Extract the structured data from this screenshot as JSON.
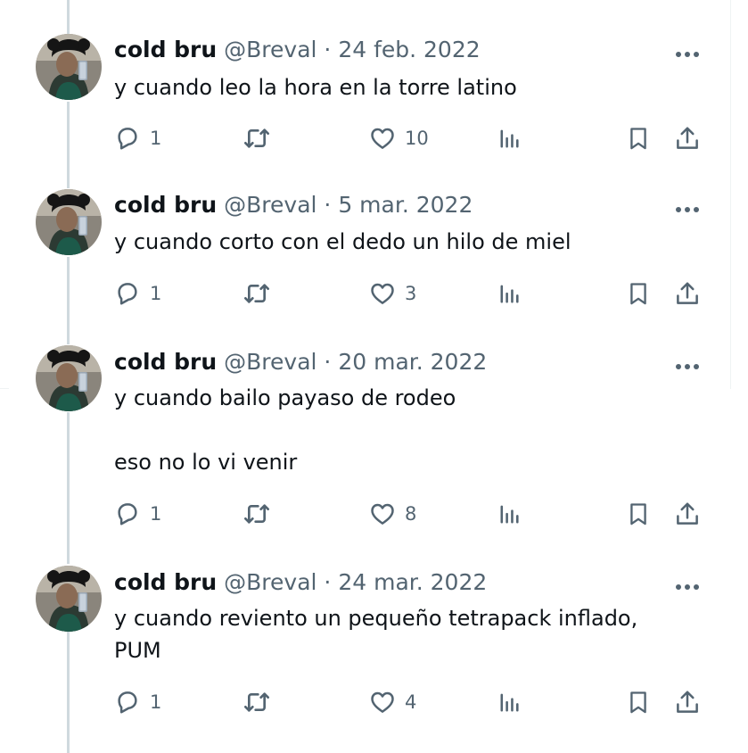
{
  "tweets": [
    {
      "name": "cold bru",
      "handle": "@Breval",
      "separator": "·",
      "date": "24 feb. 2022",
      "text": "y cuando leo la hora en la torre latino",
      "replies": "1",
      "likes": "10"
    },
    {
      "name": "cold bru",
      "handle": "@Breval",
      "separator": "·",
      "date": "5 mar. 2022",
      "text": "y cuando corto con el dedo un hilo de miel",
      "replies": "1",
      "likes": "3"
    },
    {
      "name": "cold bru",
      "handle": "@Breval",
      "separator": "·",
      "date": "20 mar. 2022",
      "text": "y cuando bailo payaso de rodeo\n\neso no lo vi venir",
      "replies": "1",
      "likes": "8"
    },
    {
      "name": "cold bru",
      "handle": "@Breval",
      "separator": "·",
      "date": "24 mar. 2022",
      "text": "y cuando reviento un pequeño tetrapack inflado, PUM",
      "replies": "1",
      "likes": "4"
    }
  ],
  "icons": {
    "reply": "reply-icon",
    "retweet": "retweet-icon",
    "like": "heart-icon",
    "views": "views-icon",
    "bookmark": "bookmark-icon",
    "share": "share-icon",
    "more": "more-icon"
  },
  "colors": {
    "text": "#0f1419",
    "secondary": "#536471",
    "thread_line": "#cfd9de"
  }
}
